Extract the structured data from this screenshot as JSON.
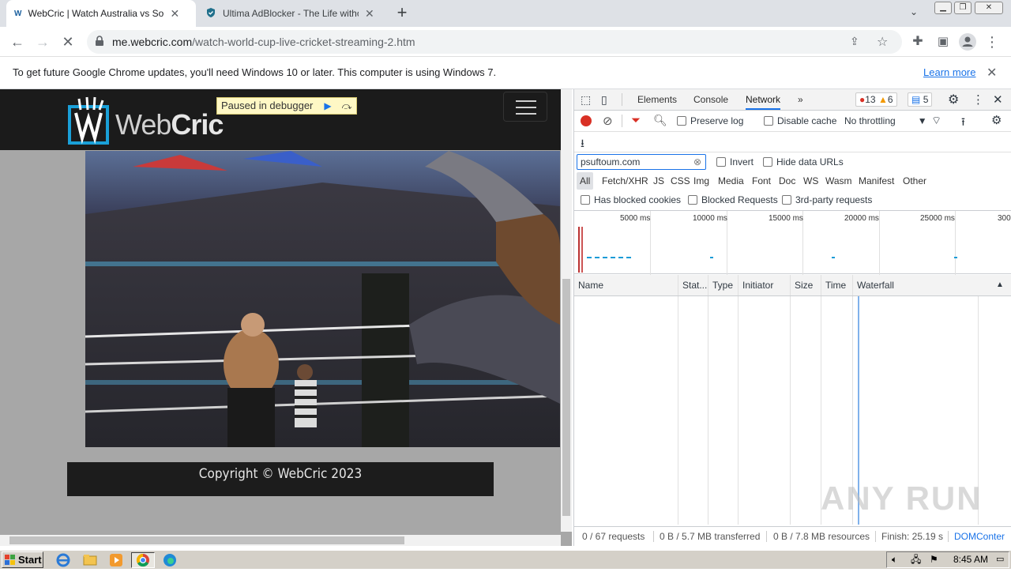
{
  "tabs": [
    {
      "title": "WebCric | Watch Australia vs South",
      "active": true
    },
    {
      "title": "Ultima AdBlocker - The Life without A",
      "active": false
    }
  ],
  "new_tab_label": "+",
  "toolbar": {
    "url_host": "me.webcric.com",
    "url_path": "/watch-world-cup-live-cricket-streaming-2.htm"
  },
  "infobar": {
    "message": "To get future Google Chrome updates, you'll need Windows 10 or later. This computer is using Windows 7.",
    "learn_more": "Learn more"
  },
  "page": {
    "logo_text_a": "Web",
    "logo_text_b": "Cric",
    "debugger_banner": "Paused in debugger",
    "footer_text": "Copyright © WebCric 2023"
  },
  "devtools": {
    "tabs": [
      "Elements",
      "Console",
      "Network"
    ],
    "active_tab": "Network",
    "more_tabs": "»",
    "errors": "13",
    "warnings": "6",
    "messages": "5",
    "preserve_log": "Preserve log",
    "disable_cache": "Disable cache",
    "throttling": "No throttling",
    "filter_value": "psuftoum.com",
    "invert": "Invert",
    "hide_data_urls": "Hide data URLs",
    "type_filters": [
      "All",
      "Fetch/XHR",
      "JS",
      "CSS",
      "Img",
      "Media",
      "Font",
      "Doc",
      "WS",
      "Wasm",
      "Manifest",
      "Other"
    ],
    "has_blocked_cookies": "Has blocked cookies",
    "blocked_requests": "Blocked Requests",
    "third_party": "3rd-party requests",
    "timeline_ticks": [
      "5000 ms",
      "10000 ms",
      "15000 ms",
      "20000 ms",
      "25000 ms",
      "300"
    ],
    "columns": [
      "Name",
      "Stat...",
      "Type",
      "Initiator",
      "Size",
      "Time",
      "Waterfall"
    ],
    "status": {
      "requests": "0 / 67 requests",
      "transferred": "0 B / 5.7 MB transferred",
      "resources": "0 B / 7.8 MB resources",
      "finish": "Finish: 25.19 s",
      "domcontent": "DOMConter"
    }
  },
  "taskbar": {
    "start": "Start",
    "clock": "8:45 AM"
  },
  "watermark": "ANY RUN"
}
